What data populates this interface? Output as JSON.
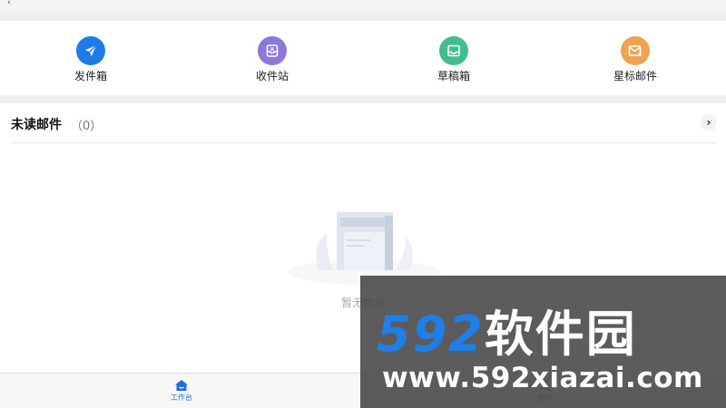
{
  "header": {
    "back_glyph": "‹"
  },
  "quick_actions": [
    {
      "label": "发件箱",
      "icon": "send-icon",
      "color": "#1f7ce6"
    },
    {
      "label": "收件站",
      "icon": "inbox-icon",
      "color": "#8c78d8"
    },
    {
      "label": "草稿箱",
      "icon": "draft-tray-icon",
      "color": "#42be8c"
    },
    {
      "label": "星标邮件",
      "icon": "star-mail-icon",
      "color": "#efa350"
    }
  ],
  "unread": {
    "title": "未读邮件",
    "count": "（0）",
    "more_glyph": "›"
  },
  "empty_state": {
    "text": "暂无数据"
  },
  "tabbar": {
    "tabs": [
      {
        "label": "工作台",
        "icon": "home-icon",
        "active": true
      },
      {
        "label": "我的",
        "icon": "profile-icon",
        "active": false
      }
    ],
    "active_color": "#1d6fe0"
  },
  "watermark": {
    "number": "592",
    "brand": "软件园",
    "url": "www.592xiazai.com"
  }
}
